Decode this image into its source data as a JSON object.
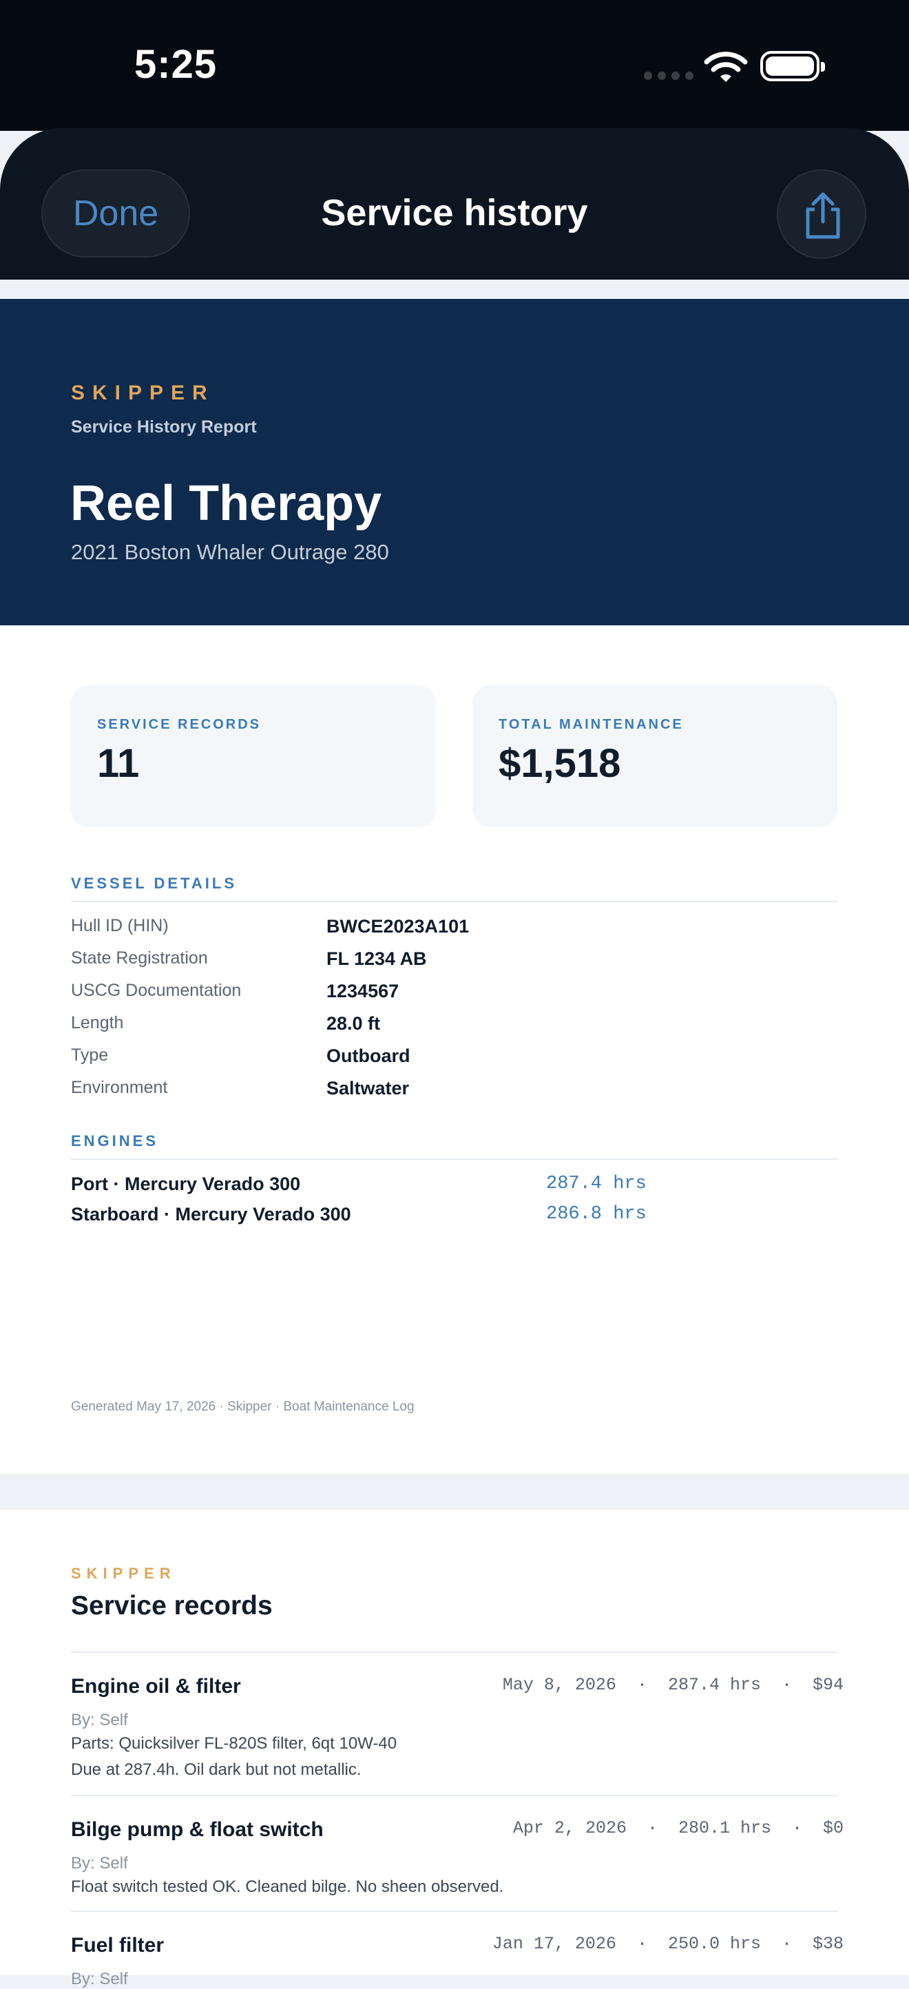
{
  "status_bar": {
    "time": "5:25"
  },
  "nav": {
    "done_label": "Done",
    "title": "Service history"
  },
  "report": {
    "brand": "SKIPPER",
    "report_label": "Service History Report",
    "vessel_name": "Reel Therapy",
    "vessel_model": "2021 Boston Whaler Outrage 280",
    "stats": [
      {
        "label": "SERVICE RECORDS",
        "value": "11"
      },
      {
        "label": "TOTAL MAINTENANCE",
        "value": "$1,518"
      }
    ],
    "vessel_details_heading": "VESSEL DETAILS",
    "details": [
      {
        "label": "Hull ID (HIN)",
        "value": "BWCE2023A101"
      },
      {
        "label": "State Registration",
        "value": "FL 1234 AB"
      },
      {
        "label": "USCG Documentation",
        "value": "1234567"
      },
      {
        "label": "Length",
        "value": "28.0 ft"
      },
      {
        "label": "Type",
        "value": "Outboard"
      },
      {
        "label": "Environment",
        "value": "Saltwater"
      }
    ],
    "engines_heading": "ENGINES",
    "engines": [
      {
        "name": "Port · Mercury Verado 300",
        "hours": "287.4 hrs"
      },
      {
        "name": "Starboard · Mercury Verado 300",
        "hours": "286.8 hrs"
      }
    ],
    "footer": "Generated May 17, 2026  ·  Skipper · Boat Maintenance Log"
  },
  "records_page": {
    "brand": "SKIPPER",
    "title": "Service records",
    "records": [
      {
        "title": "Engine oil & filter",
        "meta": "May 8, 2026  ·  287.4 hrs  ·  $94",
        "by": "By: Self",
        "parts": "Parts: Quicksilver FL-820S filter, 6qt 10W-40",
        "notes": "Due at 287.4h. Oil dark but not metallic."
      },
      {
        "title": "Bilge pump & float switch",
        "meta": "Apr 2, 2026  ·  280.1 hrs  ·  $0",
        "by": "By: Self",
        "notes": "Float switch tested OK. Cleaned bilge. No sheen observed."
      },
      {
        "title": "Fuel filter",
        "meta": "Jan 17, 2026  ·  250.0 hrs  ·  $38",
        "by": "By: Self"
      }
    ]
  }
}
